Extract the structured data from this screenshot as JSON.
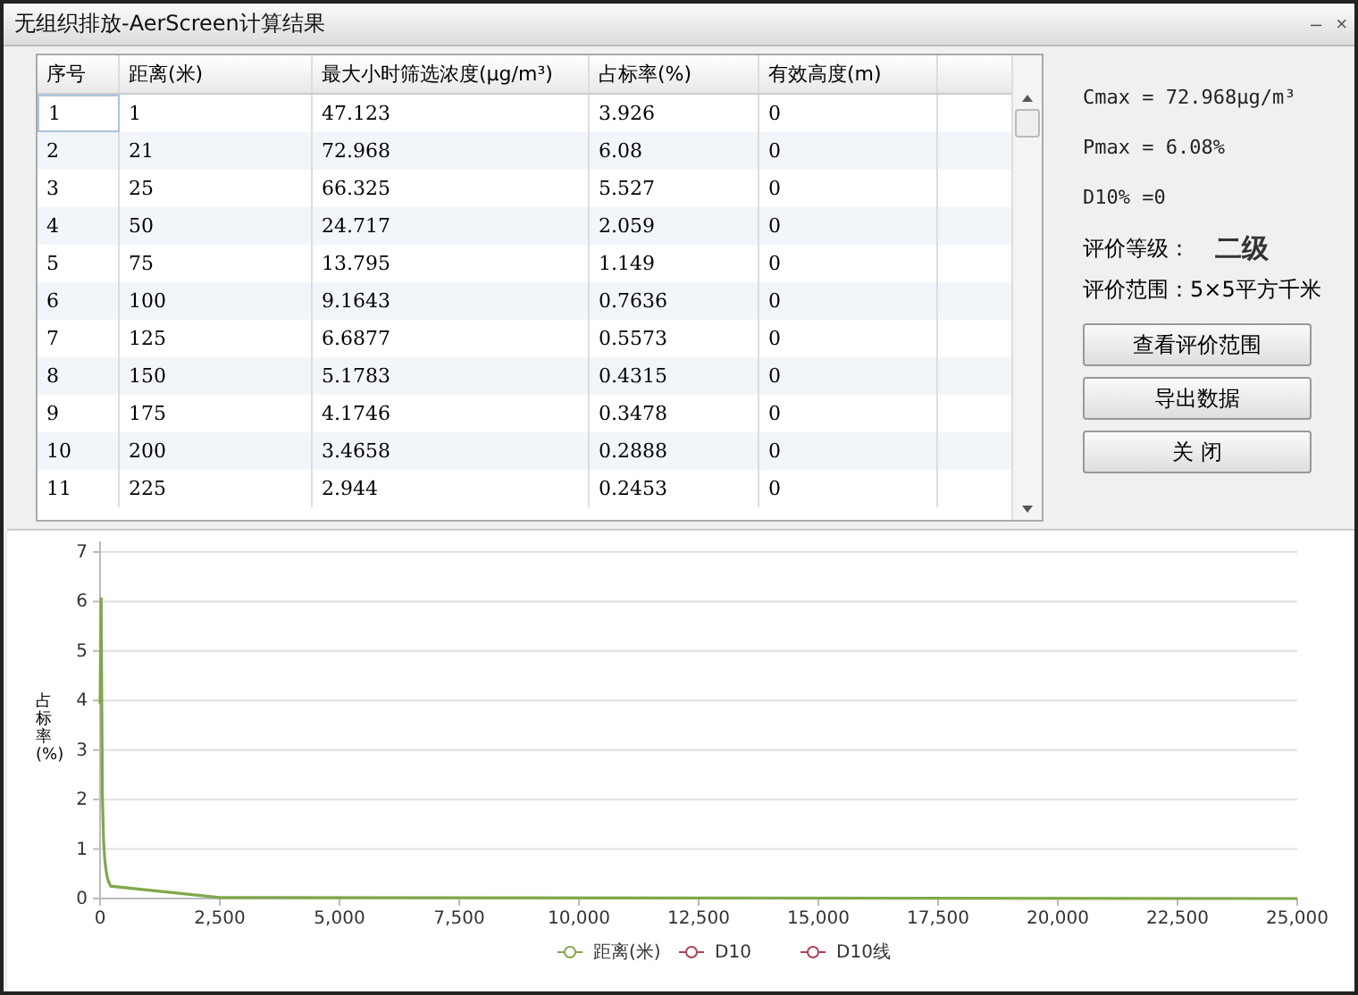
{
  "window": {
    "title": "无组织排放-AerScreen计算结果",
    "controls": [
      "–",
      "×"
    ]
  },
  "table": {
    "columns": [
      "序号",
      "距离(米)",
      "最大小时筛选浓度(μg/m³)",
      "占标率(%)",
      "有效高度(m)"
    ],
    "rows": [
      {
        "cells": [
          "1",
          "1",
          "47.123",
          "3.926",
          "0"
        ],
        "selected": true
      },
      {
        "cells": [
          "2",
          "21",
          "72.968",
          "6.08",
          "0"
        ],
        "selected": false
      },
      {
        "cells": [
          "3",
          "25",
          "66.325",
          "5.527",
          "0"
        ],
        "selected": false
      },
      {
        "cells": [
          "4",
          "50",
          "24.717",
          "2.059",
          "0"
        ],
        "selected": false
      },
      {
        "cells": [
          "5",
          "75",
          "13.795",
          "1.149",
          "0"
        ],
        "selected": false
      },
      {
        "cells": [
          "6",
          "100",
          "9.1643",
          "0.7636",
          "0"
        ],
        "selected": false
      },
      {
        "cells": [
          "7",
          "125",
          "6.6877",
          "0.5573",
          "0"
        ],
        "selected": false
      },
      {
        "cells": [
          "8",
          "150",
          "5.1783",
          "0.4315",
          "0"
        ],
        "selected": false
      },
      {
        "cells": [
          "9",
          "175",
          "4.1746",
          "0.3478",
          "0"
        ],
        "selected": false
      },
      {
        "cells": [
          "10",
          "200",
          "3.4658",
          "0.2888",
          "0"
        ],
        "selected": false
      },
      {
        "cells": [
          "11",
          "225",
          "2.944",
          "0.2453",
          "0"
        ],
        "selected": false
      }
    ]
  },
  "summary": {
    "cmax": "Cmax = 72.968μg/m³",
    "pmax": "Pmax = 6.08%",
    "d10": "D10% =0",
    "grade_label": "评价等级：",
    "grade": "二级",
    "range": "评价范围：5×5平方千米"
  },
  "buttons": [
    "查看评价范围",
    "导出数据",
    "关 闭"
  ],
  "chart": {
    "chart_data": {
      "type": "line",
      "ylabel": "占标率(%)",
      "x": [
        1,
        21,
        25,
        50,
        75,
        100,
        125,
        150,
        175,
        200,
        225,
        2500,
        25000
      ],
      "series": [
        {
          "name": "距离(米)",
          "color": "#7fa84a",
          "values": [
            3.93,
            6.08,
            5.53,
            2.06,
            1.15,
            0.76,
            0.56,
            0.43,
            0.35,
            0.29,
            0.25,
            0.02,
            0
          ]
        },
        {
          "name": "D10",
          "color": "#b04050",
          "values": [
            null,
            null,
            null,
            null,
            null,
            null,
            null,
            null,
            null,
            null,
            null,
            null,
            null
          ]
        },
        {
          "name": "D10线",
          "color": "#b04050",
          "values": [
            null,
            null,
            null,
            null,
            null,
            null,
            null,
            null,
            null,
            null,
            null,
            null,
            null
          ]
        }
      ],
      "xlim": [
        0,
        25000
      ],
      "ylim": [
        0,
        7
      ],
      "grid": true,
      "xticks": [
        {
          "value": 0,
          "label": "0"
        },
        {
          "value": 2500,
          "label": "2,500"
        },
        {
          "value": 5000,
          "label": "5,000"
        },
        {
          "value": 7500,
          "label": "7,500"
        },
        {
          "value": 10000,
          "label": "10,000"
        },
        {
          "value": 12500,
          "label": "12,500"
        },
        {
          "value": 15000,
          "label": "15,000"
        },
        {
          "value": 17500,
          "label": "17,500"
        },
        {
          "value": 20000,
          "label": "20,000"
        },
        {
          "value": 22500,
          "label": "22,500"
        },
        {
          "value": 25000,
          "label": "25,000"
        }
      ],
      "yticks": [
        0,
        1,
        2,
        3,
        4,
        5,
        6,
        7
      ]
    }
  }
}
